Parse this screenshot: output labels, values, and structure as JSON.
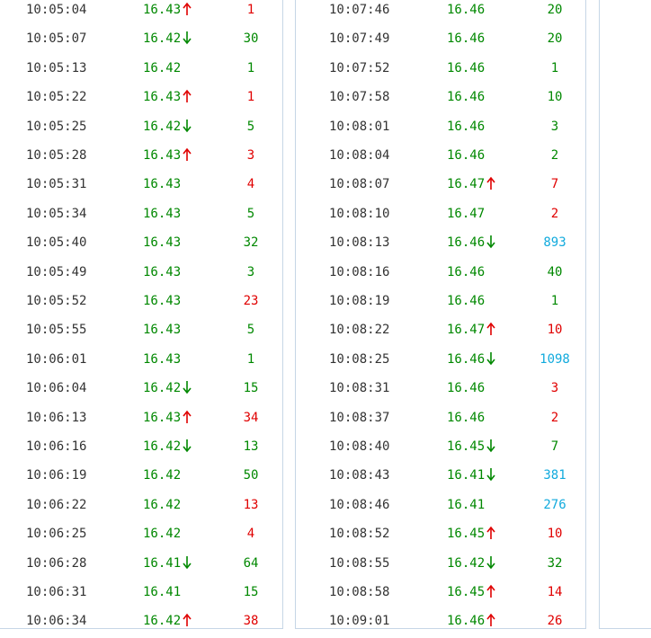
{
  "colors": {
    "green": "#008800",
    "red": "#e00000",
    "cyan": "#11aadd",
    "time": "#333333",
    "border": "#c6d6e6"
  },
  "columns": [
    {
      "rows": [
        {
          "time": "10:05:04",
          "price": "16.43",
          "dir": "up",
          "vol": "1",
          "vol_color": "red"
        },
        {
          "time": "10:05:07",
          "price": "16.42",
          "dir": "down",
          "vol": "30",
          "vol_color": "green"
        },
        {
          "time": "10:05:13",
          "price": "16.42",
          "dir": "",
          "vol": "1",
          "vol_color": "green"
        },
        {
          "time": "10:05:22",
          "price": "16.43",
          "dir": "up",
          "vol": "1",
          "vol_color": "red"
        },
        {
          "time": "10:05:25",
          "price": "16.42",
          "dir": "down",
          "vol": "5",
          "vol_color": "green"
        },
        {
          "time": "10:05:28",
          "price": "16.43",
          "dir": "up",
          "vol": "3",
          "vol_color": "red"
        },
        {
          "time": "10:05:31",
          "price": "16.43",
          "dir": "",
          "vol": "4",
          "vol_color": "red"
        },
        {
          "time": "10:05:34",
          "price": "16.43",
          "dir": "",
          "vol": "5",
          "vol_color": "green"
        },
        {
          "time": "10:05:40",
          "price": "16.43",
          "dir": "",
          "vol": "32",
          "vol_color": "green"
        },
        {
          "time": "10:05:49",
          "price": "16.43",
          "dir": "",
          "vol": "3",
          "vol_color": "green"
        },
        {
          "time": "10:05:52",
          "price": "16.43",
          "dir": "",
          "vol": "23",
          "vol_color": "red"
        },
        {
          "time": "10:05:55",
          "price": "16.43",
          "dir": "",
          "vol": "5",
          "vol_color": "green"
        },
        {
          "time": "10:06:01",
          "price": "16.43",
          "dir": "",
          "vol": "1",
          "vol_color": "green"
        },
        {
          "time": "10:06:04",
          "price": "16.42",
          "dir": "down",
          "vol": "15",
          "vol_color": "green"
        },
        {
          "time": "10:06:13",
          "price": "16.43",
          "dir": "up",
          "vol": "34",
          "vol_color": "red"
        },
        {
          "time": "10:06:16",
          "price": "16.42",
          "dir": "down",
          "vol": "13",
          "vol_color": "green"
        },
        {
          "time": "10:06:19",
          "price": "16.42",
          "dir": "",
          "vol": "50",
          "vol_color": "green"
        },
        {
          "time": "10:06:22",
          "price": "16.42",
          "dir": "",
          "vol": "13",
          "vol_color": "red"
        },
        {
          "time": "10:06:25",
          "price": "16.42",
          "dir": "",
          "vol": "4",
          "vol_color": "red"
        },
        {
          "time": "10:06:28",
          "price": "16.41",
          "dir": "down",
          "vol": "64",
          "vol_color": "green"
        },
        {
          "time": "10:06:31",
          "price": "16.41",
          "dir": "",
          "vol": "15",
          "vol_color": "green"
        },
        {
          "time": "10:06:34",
          "price": "16.42",
          "dir": "up",
          "vol": "38",
          "vol_color": "red"
        }
      ]
    },
    {
      "rows": [
        {
          "time": "10:07:46",
          "price": "16.46",
          "dir": "",
          "vol": "20",
          "vol_color": "green"
        },
        {
          "time": "10:07:49",
          "price": "16.46",
          "dir": "",
          "vol": "20",
          "vol_color": "green"
        },
        {
          "time": "10:07:52",
          "price": "16.46",
          "dir": "",
          "vol": "1",
          "vol_color": "green"
        },
        {
          "time": "10:07:58",
          "price": "16.46",
          "dir": "",
          "vol": "10",
          "vol_color": "green"
        },
        {
          "time": "10:08:01",
          "price": "16.46",
          "dir": "",
          "vol": "3",
          "vol_color": "green"
        },
        {
          "time": "10:08:04",
          "price": "16.46",
          "dir": "",
          "vol": "2",
          "vol_color": "green"
        },
        {
          "time": "10:08:07",
          "price": "16.47",
          "dir": "up",
          "vol": "7",
          "vol_color": "red"
        },
        {
          "time": "10:08:10",
          "price": "16.47",
          "dir": "",
          "vol": "2",
          "vol_color": "red"
        },
        {
          "time": "10:08:13",
          "price": "16.46",
          "dir": "down",
          "vol": "893",
          "vol_color": "cyan"
        },
        {
          "time": "10:08:16",
          "price": "16.46",
          "dir": "",
          "vol": "40",
          "vol_color": "green"
        },
        {
          "time": "10:08:19",
          "price": "16.46",
          "dir": "",
          "vol": "1",
          "vol_color": "green"
        },
        {
          "time": "10:08:22",
          "price": "16.47",
          "dir": "up",
          "vol": "10",
          "vol_color": "red"
        },
        {
          "time": "10:08:25",
          "price": "16.46",
          "dir": "down",
          "vol": "1098",
          "vol_color": "cyan"
        },
        {
          "time": "10:08:31",
          "price": "16.46",
          "dir": "",
          "vol": "3",
          "vol_color": "red"
        },
        {
          "time": "10:08:37",
          "price": "16.46",
          "dir": "",
          "vol": "2",
          "vol_color": "red"
        },
        {
          "time": "10:08:40",
          "price": "16.45",
          "dir": "down",
          "vol": "7",
          "vol_color": "green"
        },
        {
          "time": "10:08:43",
          "price": "16.41",
          "dir": "down",
          "vol": "381",
          "vol_color": "cyan"
        },
        {
          "time": "10:08:46",
          "price": "16.41",
          "dir": "",
          "vol": "276",
          "vol_color": "cyan"
        },
        {
          "time": "10:08:52",
          "price": "16.45",
          "dir": "up",
          "vol": "10",
          "vol_color": "red"
        },
        {
          "time": "10:08:55",
          "price": "16.42",
          "dir": "down",
          "vol": "32",
          "vol_color": "green"
        },
        {
          "time": "10:08:58",
          "price": "16.45",
          "dir": "up",
          "vol": "14",
          "vol_color": "red"
        },
        {
          "time": "10:09:01",
          "price": "16.46",
          "dir": "up",
          "vol": "26",
          "vol_color": "red"
        }
      ]
    }
  ]
}
